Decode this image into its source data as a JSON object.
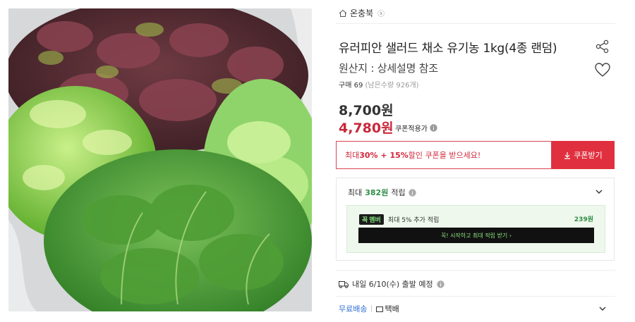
{
  "store": {
    "name": "온충북"
  },
  "product": {
    "title": "유러피안 샐러드 채소 유기농 1kg(4종 랜덤)",
    "origin": "원산지 : 상세설명 참조",
    "purchase_count": "구매 69",
    "stock": "(남은수량 926개)"
  },
  "price": {
    "original": "8,700원",
    "sale": "4,780원",
    "coupon_note": "쿠폰적용가"
  },
  "coupon": {
    "banner_prefix": "최대 ",
    "banner_bold": "30% + 15%",
    "banner_suffix": " 할인 쿠폰을 받으세요!",
    "button_label": "쿠폰받기"
  },
  "points": {
    "label_prefix": "최대 ",
    "amount": "382원",
    "label_suffix": " 적립",
    "member_badge": "멤버",
    "member_text": "최대 5% 추가 적립",
    "member_points": "239원",
    "member_cta": "꼭! 시작하고 최대 적립 받기 ›"
  },
  "shipping": {
    "schedule": "내일 6/10(수) 출발 예정",
    "free_label": "무료배송",
    "method": "택배"
  },
  "colors": {
    "sale_red": "#c8283a",
    "coupon_button": "#e0303f",
    "points_green": "#2f8d47",
    "free_ship_blue": "#2f6ed6"
  },
  "icons": [
    "house-icon",
    "chevron-right-icon",
    "share-icon",
    "heart-icon",
    "info-icon",
    "download-icon",
    "chevron-down-icon",
    "truck-icon",
    "package-icon"
  ]
}
